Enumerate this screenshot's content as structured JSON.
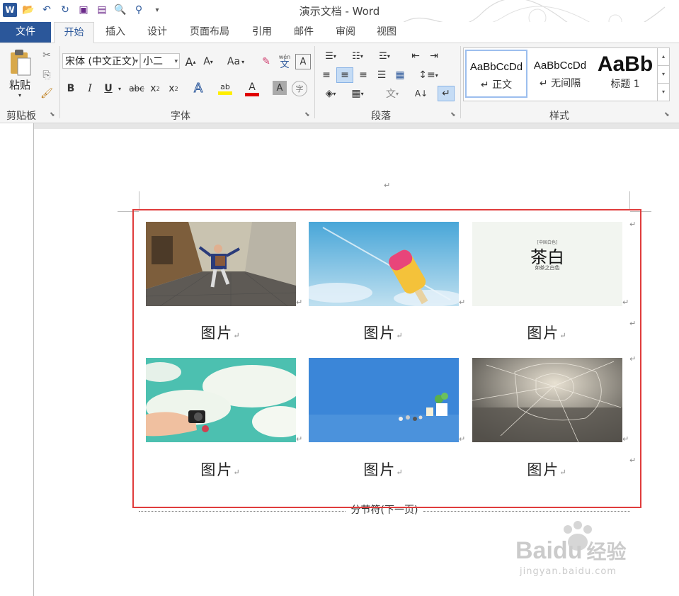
{
  "window": {
    "title": "演示文档 - Word"
  },
  "tabs": [
    "文件",
    "开始",
    "插入",
    "设计",
    "页面布局",
    "引用",
    "邮件",
    "审阅",
    "视图"
  ],
  "ribbon": {
    "clipboard": {
      "paste_label": "粘贴",
      "label": "剪贴板"
    },
    "font": {
      "name": "宋体 (中文正文)",
      "size": "小二",
      "label": "字体",
      "wen": "wén",
      "wen_char": "文",
      "case_label": "Aa"
    },
    "paragraph": {
      "label": "段落"
    },
    "styles": {
      "label": "样式",
      "items": [
        {
          "preview": "AaBbCcDd",
          "name": "↵ 正文"
        },
        {
          "preview": "AaBbCcDd",
          "name": "↵ 无间隔"
        },
        {
          "preview": "AaBb",
          "name": "标题 1"
        }
      ]
    }
  },
  "document": {
    "top_mark": "↵",
    "cell_mark": "↵",
    "image3_title": "茶白",
    "image3_small": "[中国白色]",
    "image3_sub": "如茶之白色",
    "captions": [
      "图片",
      "图片",
      "图片",
      "图片",
      "图片",
      "图片"
    ],
    "section_break": "分节符(下一页)"
  },
  "watermark": {
    "brand": "Bai",
    "brand2": "du",
    "cn": "经验",
    "url": "jingyan.baidu.com"
  },
  "colors": {
    "accent": "#2b579a",
    "highlight_box": "#e03c3c",
    "font_color_red": "#e00000",
    "highlight_yellow": "#ffee00"
  }
}
